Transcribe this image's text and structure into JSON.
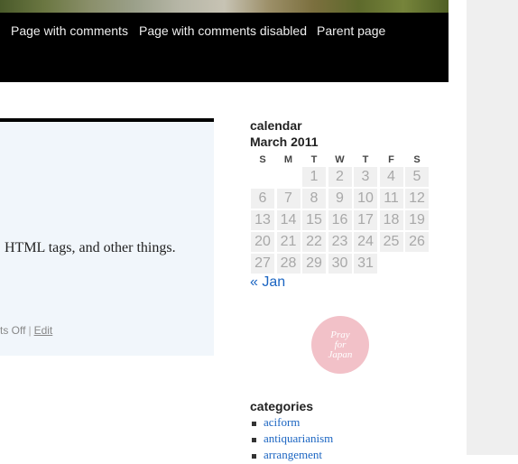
{
  "nav": {
    "items": [
      {
        "label": "Page with comments"
      },
      {
        "label": "Page with comments disabled"
      },
      {
        "label": "Parent page"
      }
    ]
  },
  "post": {
    "text": "HTML tags, and other things.",
    "meta_left": "ts Off",
    "edit_label": "Edit"
  },
  "calendar": {
    "title": "calendar",
    "caption": "March 2011",
    "weekdays": [
      "S",
      "M",
      "T",
      "W",
      "T",
      "F",
      "S"
    ],
    "rows": [
      [
        "",
        "",
        "1",
        "2",
        "3",
        "4",
        "5"
      ],
      [
        "6",
        "7",
        "8",
        "9",
        "10",
        "11",
        "12"
      ],
      [
        "13",
        "14",
        "15",
        "16",
        "17",
        "18",
        "19"
      ],
      [
        "20",
        "21",
        "22",
        "23",
        "24",
        "25",
        "26"
      ],
      [
        "27",
        "28",
        "29",
        "30",
        "31",
        "",
        ""
      ]
    ],
    "prev_link": "« Jan"
  },
  "badge": {
    "lines": [
      "Pray",
      "for",
      "Japan"
    ]
  },
  "categories": {
    "title": "categories",
    "items": [
      "aciform",
      "antiquarianism",
      "arrangement"
    ]
  },
  "colors": {
    "link": "#1b65c2",
    "nav_bg": "#000000",
    "post_bg": "#f1f6fb",
    "badge": "#f2c1c8"
  }
}
